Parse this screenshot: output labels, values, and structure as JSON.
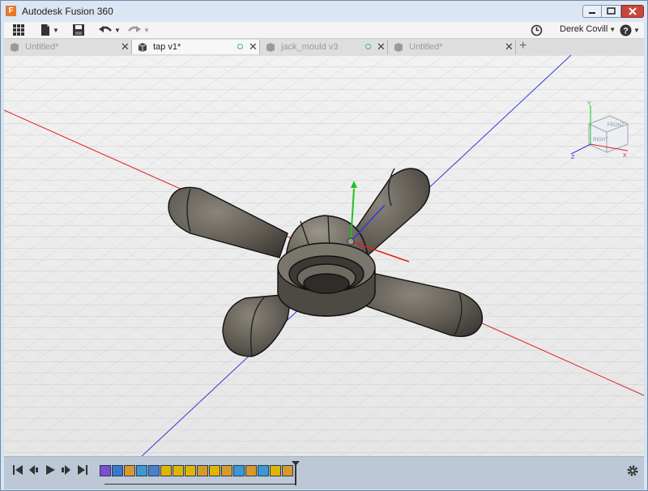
{
  "window": {
    "title": "Autodesk Fusion 360",
    "logo_letter": "F"
  },
  "toolbar": {
    "user_name": "Derek Covill"
  },
  "tabs": [
    {
      "label": "Untitled*",
      "active": false,
      "saved_indicator": false
    },
    {
      "label": "tap v1*",
      "active": true,
      "saved_indicator": true
    },
    {
      "label": "jack_mould v3",
      "active": false,
      "saved_indicator": true
    },
    {
      "label": "Untitled*",
      "active": false,
      "saved_indicator": false
    }
  ],
  "viewcube": {
    "front_label": "FRONT",
    "right_label": "RIGHT",
    "axis_x": "X",
    "axis_y": "Y",
    "axis_z": "Z"
  },
  "colors": {
    "x_axis": "#e02020",
    "y_axis": "#22c022",
    "z_axis": "#3636e0",
    "model": "#6b675f",
    "title_bg": "#dbe6f3"
  },
  "timeline": {
    "controls": [
      "skip-to-start",
      "step-back",
      "play",
      "step-forward",
      "skip-to-end"
    ],
    "features": [
      "sketch",
      "move",
      "extrude",
      "revolve",
      "combine",
      "fillet",
      "fillet",
      "fillet",
      "extrude",
      "fillet",
      "extrude",
      "revolve",
      "extrude",
      "revolve",
      "fillet",
      "extrude"
    ]
  }
}
